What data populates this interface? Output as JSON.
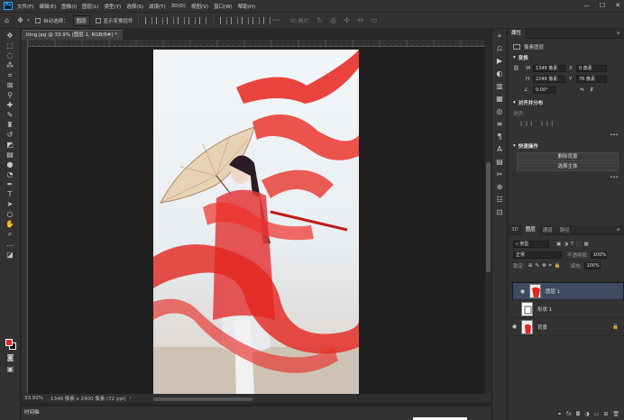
{
  "app": {
    "logo": "Ps"
  },
  "menu": [
    "文件(F)",
    "编辑(E)",
    "图像(I)",
    "图层(L)",
    "类型(Y)",
    "选择(S)",
    "滤镜(T)",
    "3D(D)",
    "视图(V)",
    "窗口(W)",
    "帮助(H)"
  ],
  "window_controls": [
    "—",
    "☐",
    "✕"
  ],
  "options": {
    "auto_select_label": "自动选择：",
    "auto_select_value": "图层",
    "transform_label": "显示变换控件",
    "mode_3d_label": "3D 模式："
  },
  "document": {
    "tab_title": "tiing.jpg @ 33.9% (图层 1, RGB/8#) *",
    "close": "×"
  },
  "status": {
    "zoom": "33.92%",
    "dimensions": "1349 像素 x 2400 像素 (72 ppi)",
    "arrow": "›"
  },
  "timeline": {
    "label": "时间轴"
  },
  "properties": {
    "tab": "属性",
    "pixel_layer": "像素图层",
    "transform_head": "变换",
    "w_label": "W",
    "w_value": "1349 像素",
    "x_label": "X",
    "x_value": "0 像素",
    "h_label": "H",
    "h_value": "2249 像素",
    "y_label": "Y",
    "y_value": "76 像素",
    "angle_value": "0.00°",
    "align_head": "对齐并分布",
    "align_label": "对齐:",
    "quick_head": "快速操作",
    "btn_remove_bg": "删除背景",
    "btn_select_subject": "选择主体",
    "more": "•••"
  },
  "layers_panel": {
    "tabs": [
      "3D",
      "图层",
      "通道",
      "路径"
    ],
    "filter_value": "类型",
    "blend_mode": "正常",
    "opacity_label": "不透明度:",
    "opacity_value": "100%",
    "lock_label": "锁定:",
    "fill_label": "填充:",
    "fill_value": "100%",
    "layers": [
      {
        "name": "图层 1",
        "visible": true,
        "selected": true
      },
      {
        "name": "形状 1",
        "visible": false,
        "selected": false
      },
      {
        "name": "背景",
        "visible": true,
        "selected": false,
        "locked": true
      }
    ],
    "footer_icons": [
      "link-icon",
      "fx-icon",
      "mask-icon",
      "adjustment-icon",
      "group-icon",
      "new-layer-icon",
      "trash-icon"
    ]
  },
  "colors": {
    "foreground": "#e32420",
    "background": "#000000",
    "panel_bg": "#323232",
    "canvas_bg": "#1f1f1f"
  }
}
